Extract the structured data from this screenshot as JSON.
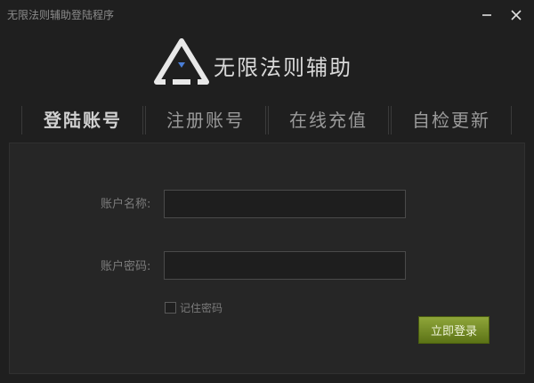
{
  "window": {
    "title": "无限法则辅助登陆程序",
    "minimize_icon": "minimize-icon",
    "close_icon": "close-icon"
  },
  "brand": {
    "logo_icon": "triangle-logo-icon",
    "name": "无限法则辅助"
  },
  "tabs": [
    {
      "label": "登陆账号",
      "active": true
    },
    {
      "label": "注册账号",
      "active": false
    },
    {
      "label": "在线充值",
      "active": false
    },
    {
      "label": "自检更新",
      "active": false
    }
  ],
  "form": {
    "username_label": "账户名称:",
    "username_value": "",
    "password_label": "账户密码:",
    "password_value": "",
    "remember_label": "记住密码",
    "remember_checked": false,
    "login_button": "立即登录"
  },
  "colors": {
    "background": "#1f1f1f",
    "panel": "#262626",
    "accent_button": "#7a9128"
  }
}
